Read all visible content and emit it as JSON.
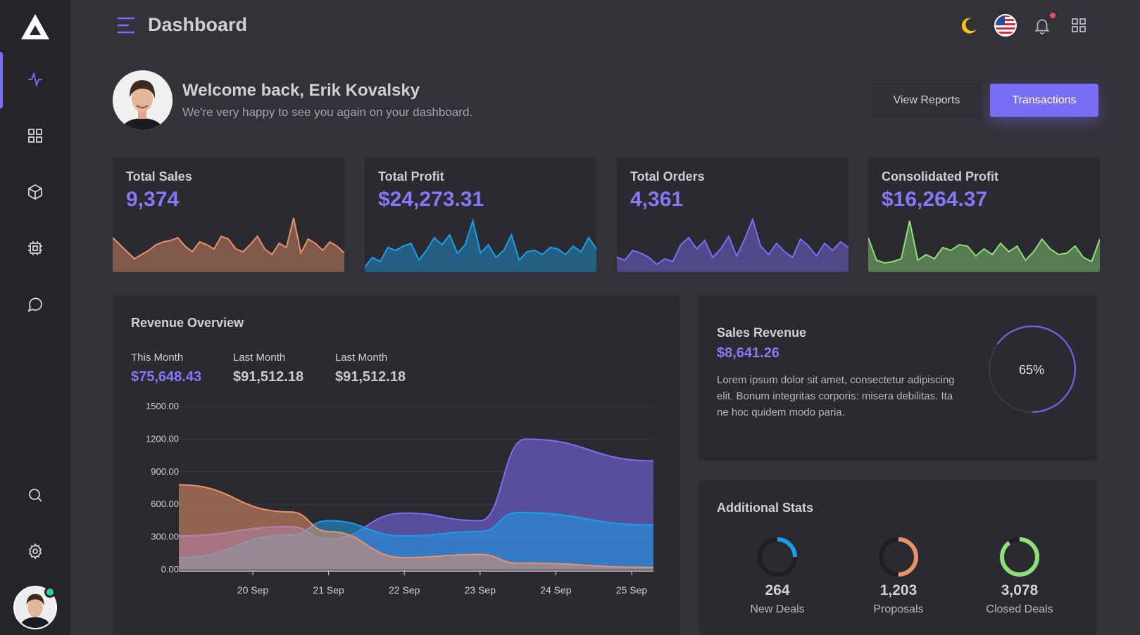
{
  "sidebar": {
    "items": [
      {
        "icon": "activity-icon",
        "active": true
      },
      {
        "icon": "grid-icon"
      },
      {
        "icon": "box-icon"
      },
      {
        "icon": "cpu-icon"
      },
      {
        "icon": "message-icon"
      },
      {
        "icon": "search-icon"
      },
      {
        "icon": "settings-icon"
      }
    ]
  },
  "header": {
    "title": "Dashboard",
    "icons": [
      "moon-icon",
      "us-flag-icon",
      "bell-icon",
      "apps-grid-icon"
    ]
  },
  "welcome": {
    "title": "Welcome back, Erik Kovalsky",
    "subtitle": "We're very happy to see you again on your dashboard.",
    "view_reports": "View Reports",
    "transactions": "Transactions"
  },
  "stats": [
    {
      "title": "Total Sales",
      "value": "9,374",
      "color": "#e8936b"
    },
    {
      "title": "Total Profit",
      "value": "$24,273.31",
      "color": "#1a9fe6"
    },
    {
      "title": "Total Orders",
      "value": "4,361",
      "color": "#7b6ef6"
    },
    {
      "title": "Consolidated Profit",
      "value": "$16,264.37",
      "color": "#8fe07a"
    }
  ],
  "revenue": {
    "title": "Revenue Overview",
    "this_month_label": "This Month",
    "this_month_value": "$75,648.43",
    "last_month_label": "Last Month",
    "last_month_value": "$91,512.18",
    "last_month2_label": "Last Month",
    "last_month2_value": "$91,512.18"
  },
  "sales_revenue": {
    "title": "Sales Revenue",
    "value": "$8,641.26",
    "text": "Lorem ipsum dolor sit amet, consectetur adipiscing elit. Bonum integritas corporis: misera debilitas. Ita ne hoc quidem modo paria.",
    "percent_label": "65%",
    "percent": 65
  },
  "additional": {
    "title": "Additional Stats",
    "items": [
      {
        "value": "264",
        "label": "New Deals",
        "color": "#1a9fe6",
        "fraction": 0.25
      },
      {
        "value": "1,203",
        "label": "Proposals",
        "color": "#e8936b",
        "fraction": 0.5
      },
      {
        "value": "3,078",
        "label": "Closed Deals",
        "color": "#8fe07a",
        "fraction": 0.9
      }
    ]
  },
  "chart_data": {
    "type": "area",
    "title": "",
    "xlabel": "",
    "ylabel": "",
    "ylim": [
      0,
      1500
    ],
    "yticks": [
      "1500.00",
      "1200.00",
      "900.00",
      "600.00",
      "300.00",
      "0.00"
    ],
    "x": [
      "20 Sep",
      "21 Sep",
      "22 Sep",
      "23 Sep",
      "24 Sep",
      "25 Sep"
    ],
    "x_positions_note": "",
    "series": [
      {
        "color": "#7b6ef6",
        "points": [
          [
            19.0,
            310
          ],
          [
            19.5,
            395
          ],
          [
            20.0,
            280
          ],
          [
            21.0,
            520
          ],
          [
            22.0,
            450
          ],
          [
            22.6,
            1200
          ],
          [
            23.6,
            1000
          ]
        ]
      },
      {
        "color": "#1a9fe6",
        "points": [
          [
            19.0,
            110
          ],
          [
            19.5,
            320
          ],
          [
            20.0,
            450
          ],
          [
            21.0,
            310
          ],
          [
            22.0,
            350
          ],
          [
            22.5,
            525
          ],
          [
            23.6,
            410
          ]
        ]
      },
      {
        "color": "#e8936b",
        "points": [
          [
            19.0,
            780
          ],
          [
            19.5,
            530
          ],
          [
            20.0,
            350
          ],
          [
            21.0,
            110
          ],
          [
            22.0,
            140
          ],
          [
            22.5,
            60
          ],
          [
            23.6,
            20
          ]
        ]
      }
    ]
  }
}
